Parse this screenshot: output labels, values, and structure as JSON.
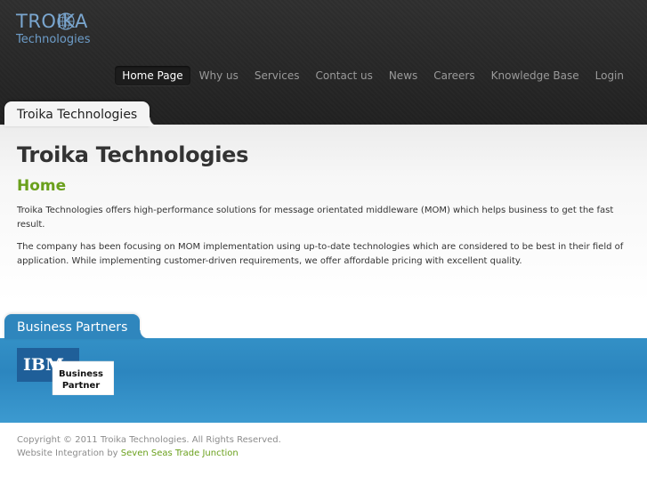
{
  "header": {
    "logo": {
      "top": "TROIKA",
      "bottom": "Technologies"
    },
    "nav": [
      {
        "label": "Home Page",
        "active": true
      },
      {
        "label": "Why us"
      },
      {
        "label": "Services"
      },
      {
        "label": "Contact us"
      },
      {
        "label": "News"
      },
      {
        "label": "Careers"
      },
      {
        "label": "Knowledge Base"
      },
      {
        "label": "Login"
      }
    ]
  },
  "main": {
    "tab_label": "Troika Technologies",
    "title": "Troika Technologies",
    "subtitle": "Home",
    "paragraphs": [
      "Troika Technologies offers high-performance solutions for message orientated middleware (MOM) which helps business to get the fast result.",
      "The company has been focusing on MOM implementation using up-to-date technologies which are considered to be best in their field of application. While implementing customer-driven requirements, we offer affordable pricing with excellent quality."
    ]
  },
  "partners": {
    "tab_label": "Business Partners",
    "badge": {
      "brand": "IBM",
      "line1": "Business",
      "line2": "Partner"
    }
  },
  "footer": {
    "copyright": "Copyright © 2011 Troika Technologies. All Rights Reserved.",
    "integration_prefix": "Website Integration by ",
    "integration_link": "Seven Seas Trade Junction"
  },
  "colors": {
    "accent_green": "#6aa01c",
    "partners_blue": "#2f86bd",
    "header_dark": "#282828"
  }
}
